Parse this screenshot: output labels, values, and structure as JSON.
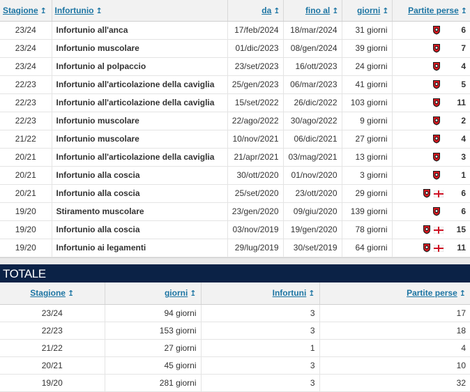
{
  "injuries": {
    "headers": {
      "season": "Stagione",
      "injury": "Infortunio",
      "from": "da",
      "until": "fino al",
      "days": "giorni",
      "games_missed": "Partite perse"
    },
    "sort_arrow": "↥",
    "rows": [
      {
        "season": "23/24",
        "injury": "Infortunio all'anca",
        "from": "17/feb/2024",
        "until": "18/mar/2024",
        "days": "31 giorni",
        "games": "6",
        "flag": false
      },
      {
        "season": "23/24",
        "injury": "Infortunio muscolare",
        "from": "01/dic/2023",
        "until": "08/gen/2024",
        "days": "39 giorni",
        "games": "7",
        "flag": false
      },
      {
        "season": "23/24",
        "injury": "Infortunio al polpaccio",
        "from": "23/set/2023",
        "until": "16/ott/2023",
        "days": "24 giorni",
        "games": "4",
        "flag": false
      },
      {
        "season": "22/23",
        "injury": "Infortunio all'articolazione della caviglia",
        "from": "25/gen/2023",
        "until": "06/mar/2023",
        "days": "41 giorni",
        "games": "5",
        "flag": false
      },
      {
        "season": "22/23",
        "injury": "Infortunio all'articolazione della caviglia",
        "from": "15/set/2022",
        "until": "26/dic/2022",
        "days": "103 giorni",
        "games": "11",
        "flag": false
      },
      {
        "season": "22/23",
        "injury": "Infortunio muscolare",
        "from": "22/ago/2022",
        "until": "30/ago/2022",
        "days": "9 giorni",
        "games": "2",
        "flag": false
      },
      {
        "season": "21/22",
        "injury": "Infortunio muscolare",
        "from": "10/nov/2021",
        "until": "06/dic/2021",
        "days": "27 giorni",
        "games": "4",
        "flag": false
      },
      {
        "season": "20/21",
        "injury": "Infortunio all'articolazione della caviglia",
        "from": "21/apr/2021",
        "until": "03/mag/2021",
        "days": "13 giorni",
        "games": "3",
        "flag": false
      },
      {
        "season": "20/21",
        "injury": "Infortunio alla coscia",
        "from": "30/ott/2020",
        "until": "01/nov/2020",
        "days": "3 giorni",
        "games": "1",
        "flag": false
      },
      {
        "season": "20/21",
        "injury": "Infortunio alla coscia",
        "from": "25/set/2020",
        "until": "23/ott/2020",
        "days": "29 giorni",
        "games": "6",
        "flag": true
      },
      {
        "season": "19/20",
        "injury": "Stiramento muscolare",
        "from": "23/gen/2020",
        "until": "09/giu/2020",
        "days": "139 giorni",
        "games": "6",
        "flag": false
      },
      {
        "season": "19/20",
        "injury": "Infortunio alla coscia",
        "from": "03/nov/2019",
        "until": "19/gen/2020",
        "days": "78 giorni",
        "games": "15",
        "flag": true
      },
      {
        "season": "19/20",
        "injury": "Infortunio ai legamenti",
        "from": "29/lug/2019",
        "until": "30/set/2019",
        "days": "64 giorni",
        "games": "11",
        "flag": true
      }
    ]
  },
  "totals": {
    "title": "TOTALE",
    "headers": {
      "season": "Stagione",
      "days": "giorni",
      "injuries": "Infortuni",
      "games_missed": "Partite perse"
    },
    "rows": [
      {
        "season": "23/24",
        "days": "94 giorni",
        "injuries": "3",
        "games": "17"
      },
      {
        "season": "22/23",
        "days": "153 giorni",
        "injuries": "3",
        "games": "18"
      },
      {
        "season": "21/22",
        "days": "27 giorni",
        "injuries": "1",
        "games": "4"
      },
      {
        "season": "20/21",
        "days": "45 giorni",
        "injuries": "3",
        "games": "10"
      },
      {
        "season": "19/20",
        "days": "281 giorni",
        "injuries": "3",
        "games": "32"
      }
    ]
  },
  "icons": {
    "club": "club-crest-icon",
    "flag": "england-flag-icon"
  },
  "colors": {
    "link": "#1d75a3",
    "total_bar": "#0b2246",
    "club_red": "#d71920",
    "club_black": "#1a1a1a"
  }
}
